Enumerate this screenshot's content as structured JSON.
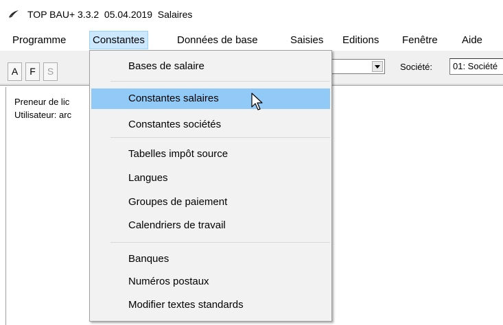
{
  "window": {
    "title": "TOP BAU+ 3.3.2  05.04.2019  Salaires"
  },
  "menubar": {
    "items": [
      "Programme",
      "Constantes",
      "Données de base",
      "Saisies",
      "Editions",
      "Fenêtre",
      "Aide"
    ]
  },
  "toolbar": {
    "buttons": [
      "A",
      "F",
      "S"
    ],
    "societe_label": "Société:",
    "societe_value": "01: Société"
  },
  "content": {
    "line1": "Preneur de lic",
    "line2": "Utilisateur: arc"
  },
  "dropdown": {
    "items": [
      "Bases de salaire",
      "Constantes salaires",
      "Constantes sociétés",
      "Tabelles impôt source",
      "Langues",
      "Groupes de paiement",
      "Calendriers de travail",
      "Banques",
      "Numéros postaux",
      "Modifier textes standards"
    ],
    "hovered": "Constantes salaires"
  },
  "colors": {
    "menu_active_bg": "#cce8ff",
    "item_hover_bg": "#91c9f7",
    "menu_bg": "#f2f2f2"
  }
}
